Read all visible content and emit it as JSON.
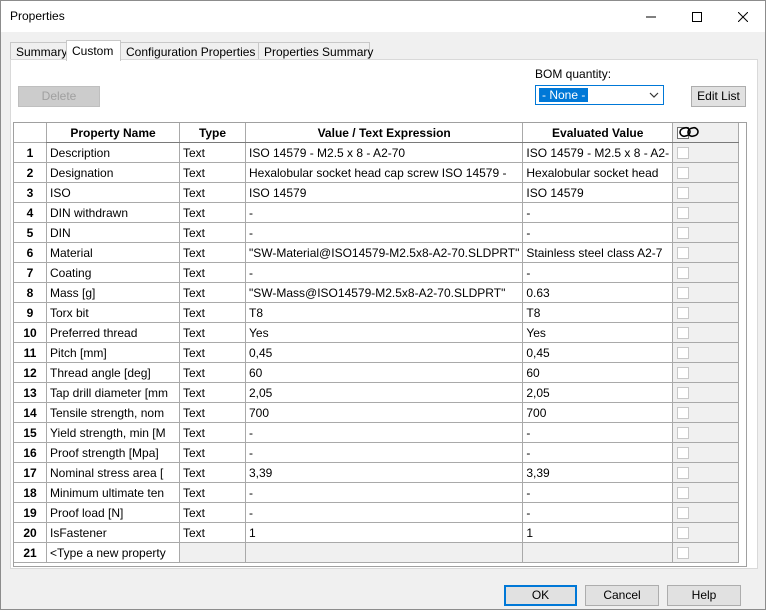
{
  "window": {
    "title": "Properties"
  },
  "tabs": [
    {
      "label": "Summary"
    },
    {
      "label": "Custom"
    },
    {
      "label": "Configuration Properties"
    },
    {
      "label": "Properties Summary"
    }
  ],
  "toolbar": {
    "delete_label": "Delete",
    "bom_label": "BOM quantity:",
    "bom_value": "- None -",
    "edit_list_label": "Edit List"
  },
  "grid": {
    "headers": {
      "name": "Property Name",
      "type": "Type",
      "value": "Value / Text Expression",
      "evaluated": "Evaluated Value"
    },
    "rows": [
      {
        "num": "1",
        "name": "Description",
        "type": "Text",
        "value": "ISO 14579 - M2.5 x 8 - A2-70",
        "evaluated": "ISO 14579 - M2.5 x 8 - A2-"
      },
      {
        "num": "2",
        "name": "Designation",
        "type": "Text",
        "value": "Hexalobular socket head cap screw ISO 14579 -",
        "evaluated": "Hexalobular socket head"
      },
      {
        "num": "3",
        "name": "ISO",
        "type": "Text",
        "value": "ISO 14579",
        "evaluated": "ISO 14579"
      },
      {
        "num": "4",
        "name": "DIN withdrawn",
        "type": "Text",
        "value": "-",
        "evaluated": "-"
      },
      {
        "num": "5",
        "name": "DIN",
        "type": "Text",
        "value": "-",
        "evaluated": "-"
      },
      {
        "num": "6",
        "name": "Material",
        "type": "Text",
        "value": "\"SW-Material@ISO14579-M2.5x8-A2-70.SLDPRT\"",
        "evaluated": "Stainless steel class A2-7"
      },
      {
        "num": "7",
        "name": "Coating",
        "type": "Text",
        "value": "-",
        "evaluated": "-"
      },
      {
        "num": "8",
        "name": "Mass [g]",
        "type": "Text",
        "value": "\"SW-Mass@ISO14579-M2.5x8-A2-70.SLDPRT\"",
        "evaluated": "0.63"
      },
      {
        "num": "9",
        "name": "Torx bit",
        "type": "Text",
        "value": "T8",
        "evaluated": "T8"
      },
      {
        "num": "10",
        "name": "Preferred thread",
        "type": "Text",
        "value": "Yes",
        "evaluated": "Yes"
      },
      {
        "num": "11",
        "name": "Pitch [mm]",
        "type": "Text",
        "value": "0,45",
        "evaluated": "0,45"
      },
      {
        "num": "12",
        "name": "Thread angle [deg]",
        "type": "Text",
        "value": "60",
        "evaluated": "60"
      },
      {
        "num": "13",
        "name": "Tap drill diameter [mm",
        "type": "Text",
        "value": "2,05",
        "evaluated": "2,05"
      },
      {
        "num": "14",
        "name": "Tensile strength, nom",
        "type": "Text",
        "value": "700",
        "evaluated": "700"
      },
      {
        "num": "15",
        "name": "Yield strength, min [M",
        "type": "Text",
        "value": "-",
        "evaluated": "-"
      },
      {
        "num": "16",
        "name": "Proof strength [Mpa]",
        "type": "Text",
        "value": "-",
        "evaluated": "-"
      },
      {
        "num": "17",
        "name": "Nominal stress area [",
        "type": "Text",
        "value": "3,39",
        "evaluated": "3,39"
      },
      {
        "num": "18",
        "name": "Minimum ultimate ten",
        "type": "Text",
        "value": "-",
        "evaluated": "-"
      },
      {
        "num": "19",
        "name": "Proof load [N]",
        "type": "Text",
        "value": "-",
        "evaluated": "-"
      },
      {
        "num": "20",
        "name": "IsFastener",
        "type": "Text",
        "value": "1",
        "evaluated": "1"
      },
      {
        "num": "21",
        "name": "<Type a new property",
        "type": "",
        "value": "",
        "evaluated": ""
      }
    ]
  },
  "footer": {
    "ok_label": "OK",
    "cancel_label": "Cancel",
    "help_label": "Help"
  },
  "icons": {
    "link": "link-icon",
    "minimize": "minimize-icon",
    "maximize": "maximize-icon",
    "close": "close-icon",
    "dropdown": "chevron-down-icon"
  },
  "colors": {
    "accent": "#0078d7"
  }
}
